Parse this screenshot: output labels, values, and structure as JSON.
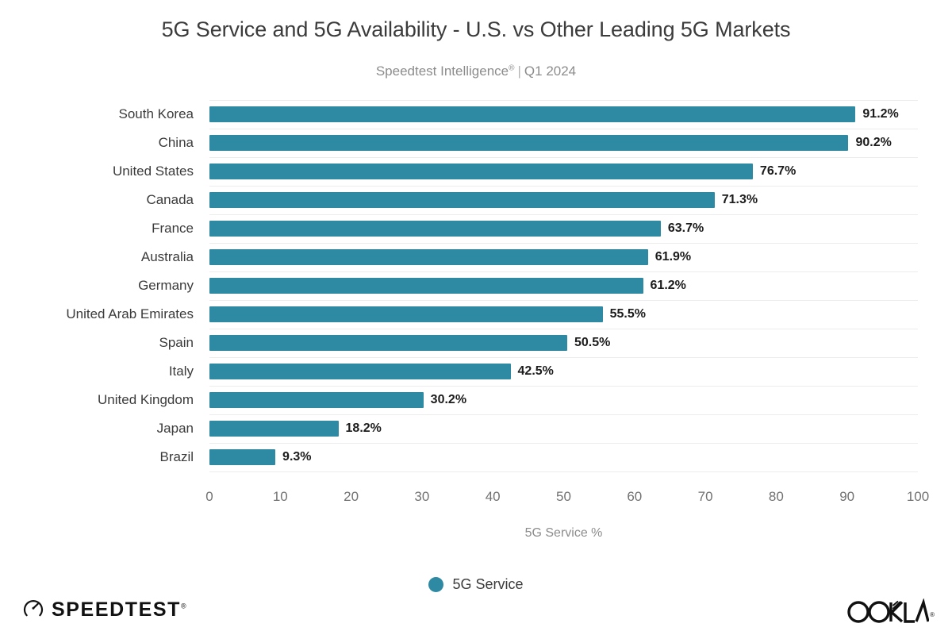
{
  "chart_data": {
    "type": "bar",
    "orientation": "horizontal",
    "title": "5G Service and 5G Availability - U.S. vs Other Leading 5G Markets",
    "subtitle_source": "Speedtest Intelligence",
    "subtitle_registered": "®",
    "subtitle_separator": "|",
    "subtitle_period": "Q1 2024",
    "categories": [
      "South Korea",
      "China",
      "United States",
      "Canada",
      "France",
      "Australia",
      "Germany",
      "United Arab Emirates",
      "Spain",
      "Italy",
      "United Kingdom",
      "Japan",
      "Brazil"
    ],
    "values": [
      91.2,
      90.2,
      76.7,
      71.3,
      63.7,
      61.9,
      61.2,
      55.5,
      50.5,
      42.5,
      30.2,
      18.2,
      9.3
    ],
    "value_labels": [
      "91.2%",
      "90.2%",
      "76.7%",
      "71.3%",
      "63.7%",
      "61.9%",
      "61.2%",
      "55.5%",
      "50.5%",
      "42.5%",
      "30.2%",
      "18.2%",
      "9.3%"
    ],
    "xlabel": "5G Service %",
    "ylabel": "",
    "xlim": [
      0,
      100
    ],
    "xticks": [
      0,
      10,
      20,
      30,
      40,
      50,
      60,
      70,
      80,
      90,
      100
    ],
    "xtick_labels": [
      "0",
      "10",
      "20",
      "30",
      "40",
      "50",
      "60",
      "70",
      "80",
      "90",
      "100"
    ],
    "grid": true,
    "grid_axis": "y",
    "legend": {
      "position": "bottom-center",
      "entries": [
        {
          "name": "5G Service",
          "color": "#2e89a3"
        }
      ]
    },
    "series": [
      {
        "name": "5G Service",
        "color": "#2e89a3",
        "values": [
          91.2,
          90.2,
          76.7,
          71.3,
          63.7,
          61.9,
          61.2,
          55.5,
          50.5,
          42.5,
          30.2,
          18.2,
          9.3
        ]
      }
    ]
  },
  "colors": {
    "bar": "#2e89a3",
    "title_text": "#3b3b3b",
    "subtitle_text": "#8c8c8c",
    "value_text": "#1c1c1c",
    "gridline": "#ececec",
    "background": "#ffffff"
  },
  "footer": {
    "speedtest_wordmark": "SPEEDTEST",
    "speedtest_trademark": "®",
    "speedtest_icon": "speedometer-gauge-icon",
    "ookla_wordmark": "OOKLA",
    "ookla_trademark": "®"
  }
}
